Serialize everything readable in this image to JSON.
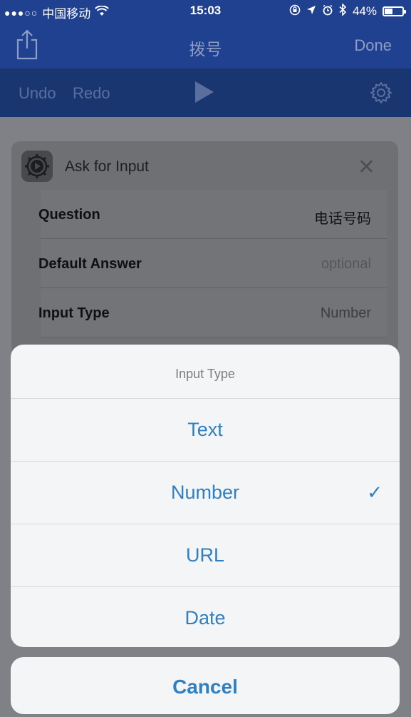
{
  "status_bar": {
    "signal": "●●●○○",
    "carrier": "中国移动",
    "time": "15:03",
    "battery_pct": "44%",
    "battery_level": 0.44
  },
  "nav": {
    "title": "拨号",
    "done_label": "Done"
  },
  "toolbar": {
    "undo_label": "Undo",
    "redo_label": "Redo"
  },
  "card": {
    "title": "Ask for Input",
    "rows": [
      {
        "label": "Question",
        "value": "电话号码"
      },
      {
        "label": "Default Answer",
        "value": "optional"
      },
      {
        "label": "Input Type",
        "value": "Number"
      }
    ]
  },
  "sheet": {
    "title": "Input Type",
    "options": [
      "Text",
      "Number",
      "URL",
      "Date"
    ],
    "selected": "Number",
    "check_glyph": "✓",
    "cancel_label": "Cancel"
  },
  "colors": {
    "nav_bg": "#1f418f",
    "toolbar_bg": "#1a3670",
    "accent": "#2f7fc1"
  }
}
